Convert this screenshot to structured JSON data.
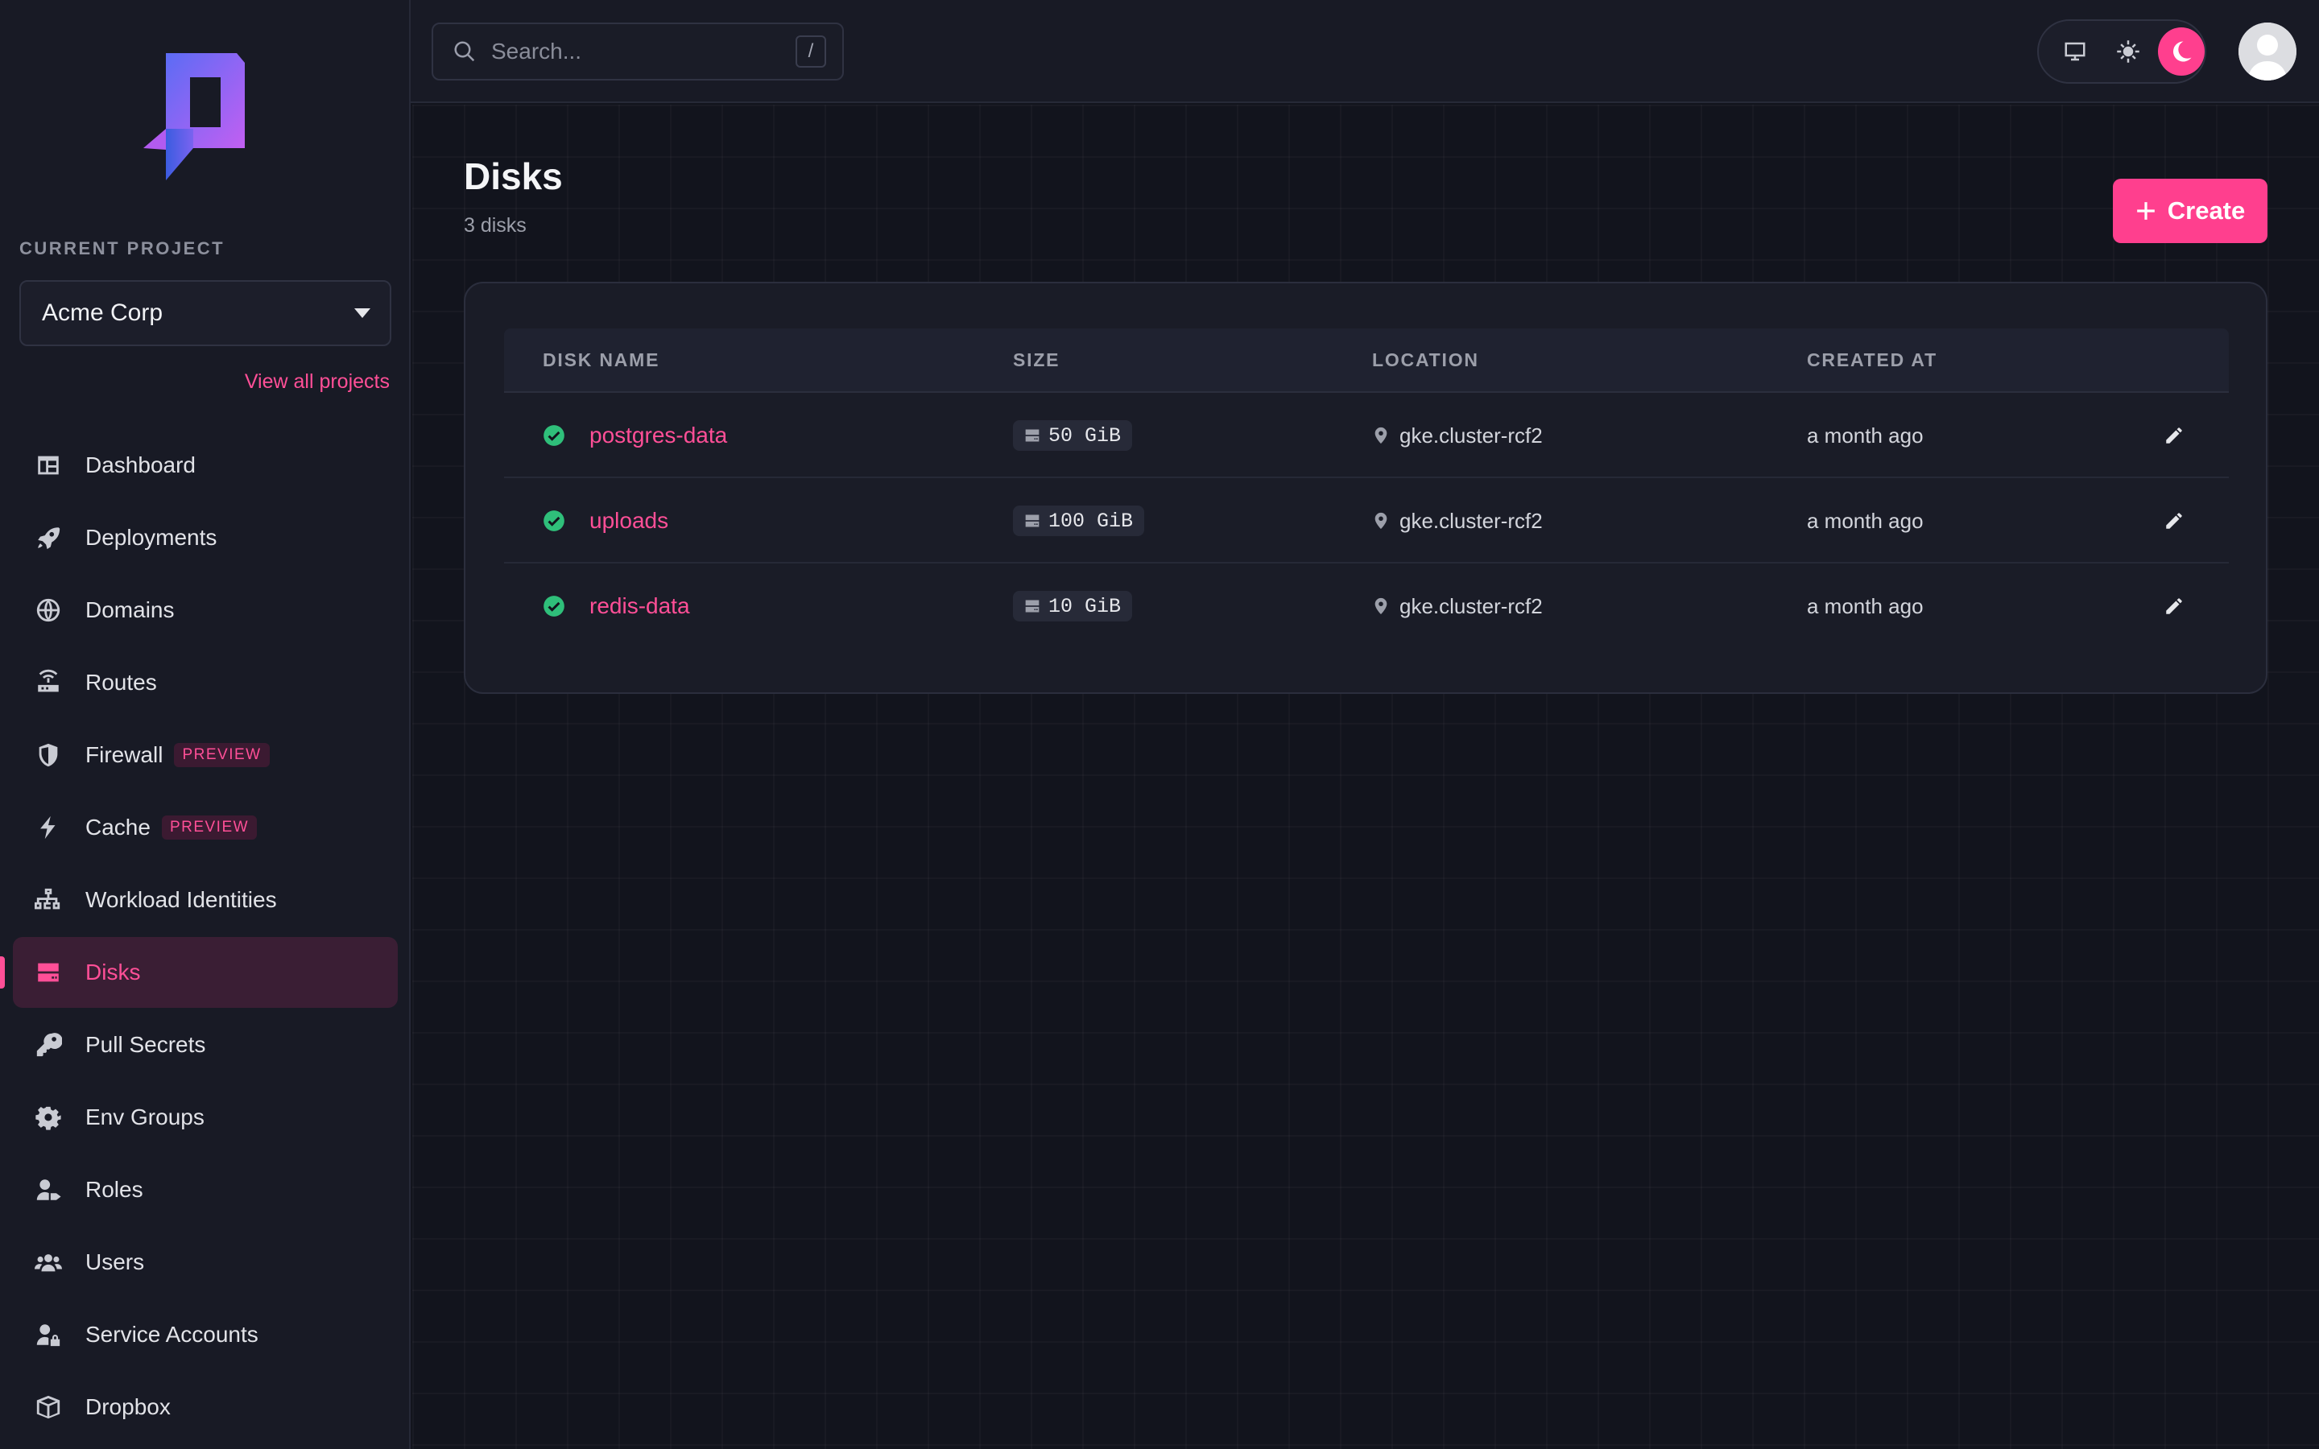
{
  "colors": {
    "accent": "#ff3f8e",
    "accent_text": "#ff4f97",
    "success": "#2fbf7a",
    "background": "#12141d",
    "sidebar": "#181a25"
  },
  "sidebar": {
    "project_label": "CURRENT PROJECT",
    "project_name": "Acme Corp",
    "view_all": "View all projects",
    "items": [
      {
        "label": "Dashboard",
        "icon": "dashboard-icon"
      },
      {
        "label": "Deployments",
        "icon": "rocket-icon"
      },
      {
        "label": "Domains",
        "icon": "globe-icon"
      },
      {
        "label": "Routes",
        "icon": "router-icon"
      },
      {
        "label": "Firewall",
        "icon": "shield-icon",
        "badge": "PREVIEW"
      },
      {
        "label": "Cache",
        "icon": "bolt-icon",
        "badge": "PREVIEW"
      },
      {
        "label": "Workload Identities",
        "icon": "sitemap-icon"
      },
      {
        "label": "Disks",
        "icon": "hard-drive-icon",
        "active": true
      },
      {
        "label": "Pull Secrets",
        "icon": "key-icon"
      },
      {
        "label": "Env Groups",
        "icon": "gear-icon"
      },
      {
        "label": "Roles",
        "icon": "user-tag-icon"
      },
      {
        "label": "Users",
        "icon": "users-icon"
      },
      {
        "label": "Service Accounts",
        "icon": "user-lock-icon"
      },
      {
        "label": "Dropbox",
        "icon": "box-icon"
      }
    ]
  },
  "topbar": {
    "search_placeholder": "Search...",
    "search_shortcut": "/",
    "theme_options": [
      "desktop-icon",
      "sun-icon",
      "moon-icon"
    ],
    "theme_selected": "moon-icon"
  },
  "page": {
    "title": "Disks",
    "subtitle": "3 disks",
    "create_label": "Create"
  },
  "table": {
    "columns": [
      "DISK NAME",
      "SIZE",
      "LOCATION",
      "CREATED AT"
    ],
    "rows": [
      {
        "name": "postgres-data",
        "size": "50 GiB",
        "location": "gke.cluster-rcf2",
        "created": "a month ago",
        "status": "ok"
      },
      {
        "name": "uploads",
        "size": "100 GiB",
        "location": "gke.cluster-rcf2",
        "created": "a month ago",
        "status": "ok"
      },
      {
        "name": "redis-data",
        "size": "10 GiB",
        "location": "gke.cluster-rcf2",
        "created": "a month ago",
        "status": "ok"
      }
    ]
  }
}
